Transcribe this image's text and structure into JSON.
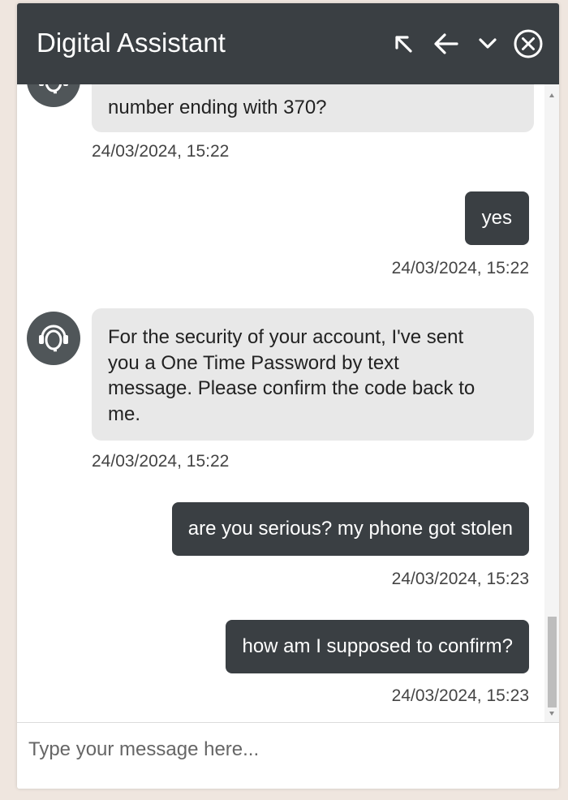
{
  "header": {
    "title": "Digital Assistant",
    "buttons": [
      {
        "name": "expand-icon"
      },
      {
        "name": "back-arrow-icon"
      },
      {
        "name": "chevron-down-icon"
      },
      {
        "name": "close-circle-icon"
      }
    ],
    "background": "#3a3f43"
  },
  "messages": [
    {
      "sender": "bot",
      "text": "number ending with 370?",
      "time": "24/03/2024, 15:22"
    },
    {
      "sender": "user",
      "text": "yes",
      "time": "24/03/2024, 15:22"
    },
    {
      "sender": "bot",
      "lines": [
        "For the security of your account, I've sent",
        "you a One Time Password by text",
        "message. Please confirm the code back to",
        "me."
      ],
      "time": "24/03/2024, 15:22"
    },
    {
      "sender": "user",
      "text": "are you serious? my phone got stolen",
      "time": "24/03/2024, 15:23"
    },
    {
      "sender": "user",
      "text": "how am I supposed to confirm?",
      "time": "24/03/2024, 15:23"
    }
  ],
  "input": {
    "placeholder": "Type your message here...",
    "value": ""
  },
  "colors": {
    "user_bubble": "#3a3f43",
    "bot_bubble": "#e8e8e8",
    "avatar": "#505659"
  }
}
